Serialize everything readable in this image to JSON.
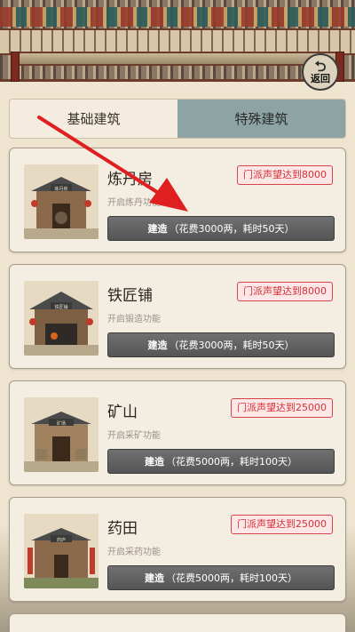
{
  "back_button": {
    "icon": "return-arrow-icon",
    "label": "返回"
  },
  "tabs": [
    {
      "label": "基础建筑",
      "active": false
    },
    {
      "label": "特殊建筑",
      "active": true
    }
  ],
  "buildings": [
    {
      "name": "炼丹房",
      "description": "开启炼丹功能",
      "requirement": "门派声望达到8000",
      "build_action": "建造",
      "build_detail": "（花费3000两，耗时50天）",
      "sign": "炼丹房"
    },
    {
      "name": "铁匠铺",
      "description": "开启锻造功能",
      "requirement": "门派声望达到8000",
      "build_action": "建造",
      "build_detail": "（花费3000两，耗时50天）",
      "sign": "铁匠铺"
    },
    {
      "name": "矿山",
      "description": "开启采矿功能",
      "requirement": "门派声望达到25000",
      "build_action": "建造",
      "build_detail": "（花费5000两，耗时100天）",
      "sign": "矿场"
    },
    {
      "name": "药田",
      "description": "开启采药功能",
      "requirement": "门派声望达到25000",
      "build_action": "建造",
      "build_detail": "（花费5000两，耗时100天）",
      "sign": "药庐"
    }
  ],
  "colors": {
    "background": "#efe4d0",
    "active_tab": "#8ea4a4",
    "requirement_red": "#d6303a",
    "build_button": "#5f5f5f",
    "guide_arrow": "#e02020"
  }
}
